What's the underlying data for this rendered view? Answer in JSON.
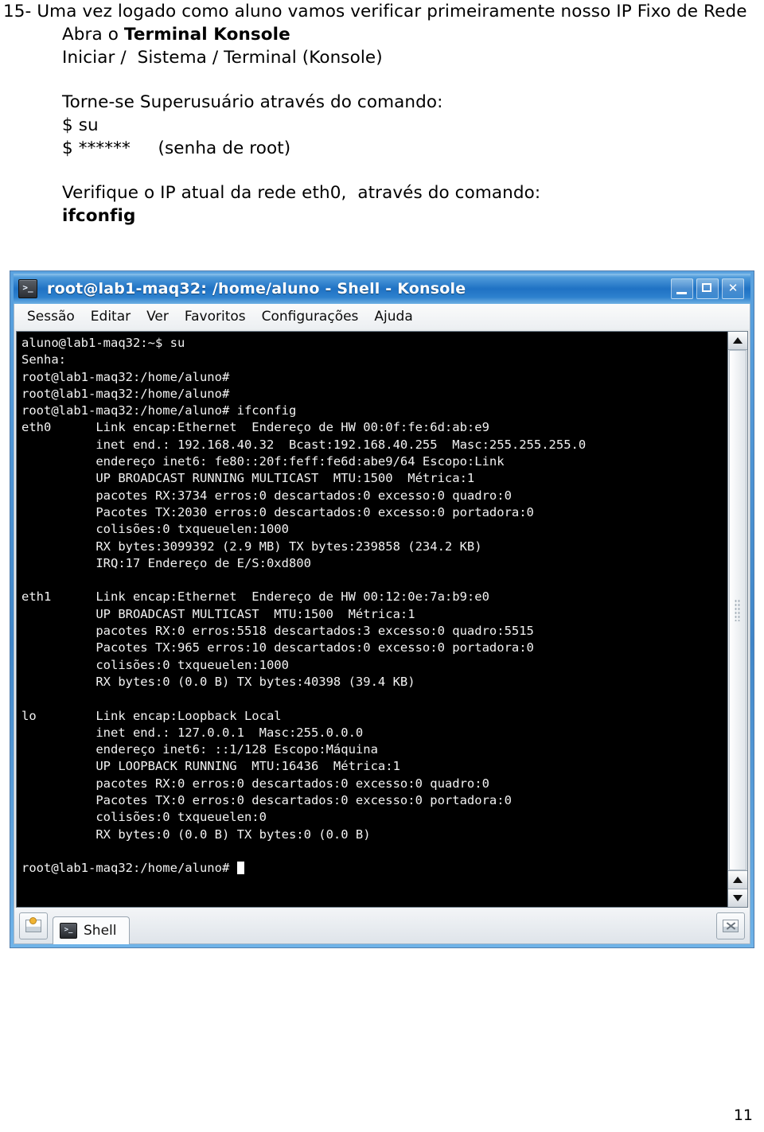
{
  "document": {
    "paragraphs": [
      {
        "id": "intro",
        "indent": false,
        "text": "15- Uma vez logado como aluno vamos verificar primeiramente nosso IP Fixo de Rede"
      },
      {
        "id": "abra",
        "indent": true,
        "prefix": "Abra o ",
        "bold": "Terminal Konsole"
      },
      {
        "id": "caminho",
        "indent": true,
        "text": "Iniciar /  Sistema / Terminal (Konsole)"
      },
      {
        "id": "torne",
        "indent": true,
        "text": "Torne-se Superusuário através do comando:"
      },
      {
        "id": "su",
        "indent": true,
        "text": "$ su"
      },
      {
        "id": "senha",
        "indent": true,
        "text": "$ ******     (senha de root)"
      },
      {
        "id": "verifique",
        "indent": true,
        "text": "Verifique o IP atual da rede eth0,  através do comando:"
      },
      {
        "id": "ifconfig",
        "indent": true,
        "bold": "ifconfig"
      }
    ],
    "page_number": "11"
  },
  "konsole": {
    "titlebar": {
      "icon": "terminal-icon",
      "title": "root@lab1-maq32: /home/aluno - Shell - Konsole",
      "minimize_label": "_",
      "maximize_label": "□",
      "close_label": "✕"
    },
    "menubar": {
      "items": [
        {
          "label": "Sessão"
        },
        {
          "label": "Editar"
        },
        {
          "label": "Ver"
        },
        {
          "label": "Favoritos"
        },
        {
          "label": "Configurações"
        },
        {
          "label": "Ajuda"
        }
      ]
    },
    "terminal_lines": [
      "aluno@lab1-maq32:~$ su",
      "Senha:",
      "root@lab1-maq32:/home/aluno#",
      "root@lab1-maq32:/home/aluno#",
      "root@lab1-maq32:/home/aluno# ifconfig",
      "eth0      Link encap:Ethernet  Endereço de HW 00:0f:fe:6d:ab:e9",
      "          inet end.: 192.168.40.32  Bcast:192.168.40.255  Masc:255.255.255.0",
      "          endereço inet6: fe80::20f:feff:fe6d:abe9/64 Escopo:Link",
      "          UP BROADCAST RUNNING MULTICAST  MTU:1500  Métrica:1",
      "          pacotes RX:3734 erros:0 descartados:0 excesso:0 quadro:0",
      "          Pacotes TX:2030 erros:0 descartados:0 excesso:0 portadora:0",
      "          colisões:0 txqueuelen:1000",
      "          RX bytes:3099392 (2.9 MB) TX bytes:239858 (234.2 KB)",
      "          IRQ:17 Endereço de E/S:0xd800",
      "",
      "eth1      Link encap:Ethernet  Endereço de HW 00:12:0e:7a:b9:e0",
      "          UP BROADCAST MULTICAST  MTU:1500  Métrica:1",
      "          pacotes RX:0 erros:5518 descartados:3 excesso:0 quadro:5515",
      "          Pacotes TX:965 erros:10 descartados:0 excesso:0 portadora:0",
      "          colisões:0 txqueuelen:1000",
      "          RX bytes:0 (0.0 B) TX bytes:40398 (39.4 KB)",
      "",
      "lo        Link encap:Loopback Local",
      "          inet end.: 127.0.0.1  Masc:255.0.0.0",
      "          endereço inet6: ::1/128 Escopo:Máquina",
      "          UP LOOPBACK RUNNING  MTU:16436  Métrica:1",
      "          pacotes RX:0 erros:0 descartados:0 excesso:0 quadro:0",
      "          Pacotes TX:0 erros:0 descartados:0 excesso:0 portadora:0",
      "          colisões:0 txqueuelen:0",
      "          RX bytes:0 (0.0 B) TX bytes:0 (0.0 B)",
      ""
    ],
    "prompt_line": "root@lab1-maq32:/home/aluno# ",
    "tabbar": {
      "new_tab_icon": "new-tab-icon",
      "tabs": [
        {
          "label": "Shell",
          "icon": "terminal-icon",
          "active": true
        }
      ],
      "close_tab_icon": "close-tab-icon"
    },
    "colors": {
      "titlebar_blue": "#1f72c4",
      "terminal_bg": "#000000",
      "terminal_fg": "#f2f2f2",
      "window_frame": "#4f7cad"
    }
  }
}
